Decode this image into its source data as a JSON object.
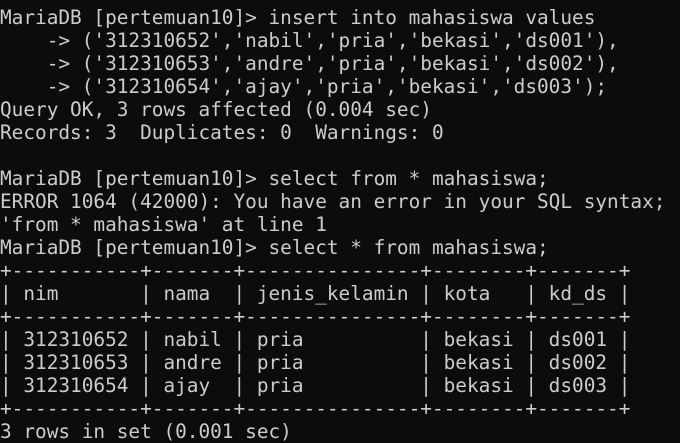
{
  "terminal": {
    "lines": [
      "MariaDB [pertemuan10]> insert into mahasiswa values",
      "    -> ('312310652','nabil','pria','bekasi','ds001'),",
      "    -> ('312310653','andre','pria','bekasi','ds002'),",
      "    -> ('312310654','ajay','pria','bekasi','ds003');",
      "Query OK, 3 rows affected (0.004 sec)",
      "Records: 3  Duplicates: 0  Warnings: 0",
      "",
      "MariaDB [pertemuan10]> select from * mahasiswa;",
      "ERROR 1064 (42000): You have an error in your SQL syntax;",
      "'from * mahasiswa' at line 1",
      "MariaDB [pertemuan10]> select * from mahasiswa;",
      "+-----------+-------+---------------+--------+-------+",
      "| nim       | nama  | jenis_kelamin | kota   | kd_ds |",
      "+-----------+-------+---------------+--------+-------+",
      "| 312310652 | nabil | pria          | bekasi | ds001 |",
      "| 312310653 | andre | pria          | bekasi | ds002 |",
      "| 312310654 | ajay  | pria          | bekasi | ds003 |",
      "+-----------+-------+---------------+--------+-------+",
      "3 rows in set (0.001 sec)"
    ]
  }
}
